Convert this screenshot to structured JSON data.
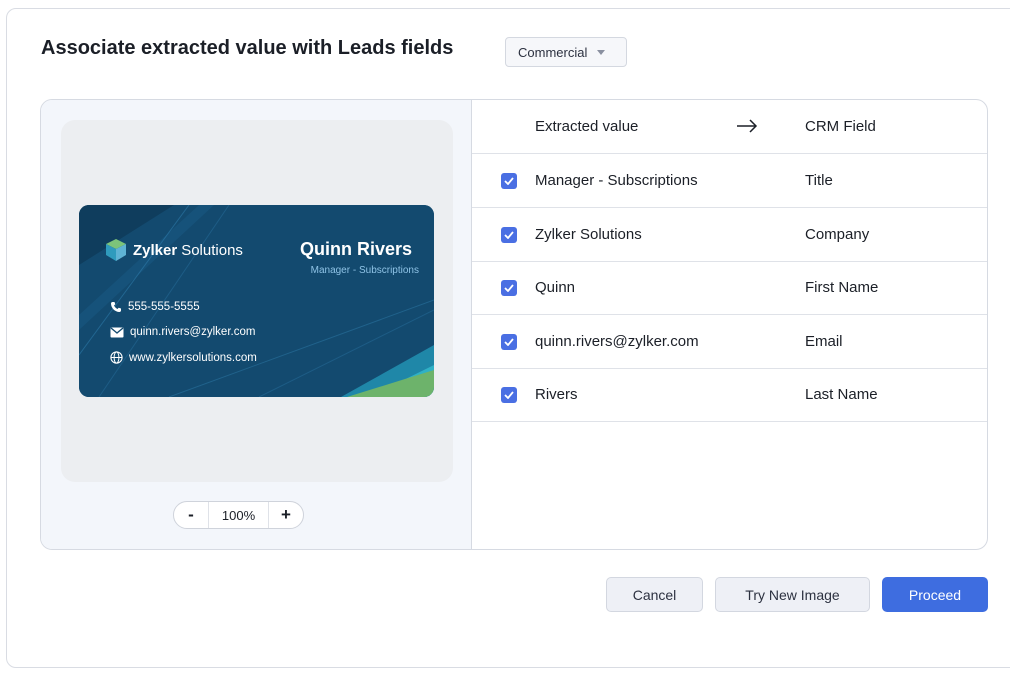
{
  "dialog": {
    "title": "Associate extracted value with Leads fields",
    "layout_select": {
      "value": "Commercial"
    }
  },
  "preview": {
    "card": {
      "brand_bold": "Zylker",
      "brand_rest": "Solutions",
      "name": "Quinn Rivers",
      "role": "Manager - Subscriptions",
      "phone": "555-555-5555",
      "email": "quinn.rivers@zylker.com",
      "website": "www.zylkersolutions.com"
    },
    "zoom": {
      "minus": "-",
      "value": "100%",
      "plus": "+"
    }
  },
  "mapping": {
    "header": {
      "extracted": "Extracted value",
      "crm": "CRM Field"
    },
    "rows": [
      {
        "value": "Manager - Subscriptions",
        "field": "Title",
        "checked": true
      },
      {
        "value": "Zylker Solutions",
        "field": "Company",
        "checked": true
      },
      {
        "value": "Quinn",
        "field": "First Name",
        "checked": true
      },
      {
        "value": "quinn.rivers@zylker.com",
        "field": "Email",
        "checked": true
      },
      {
        "value": "Rivers",
        "field": "Last Name",
        "checked": true
      }
    ]
  },
  "actions": {
    "cancel": "Cancel",
    "try_new": "Try New Image",
    "proceed": "Proceed"
  },
  "colors": {
    "accent": "#3e6de0",
    "checkbox": "#4a6fe3",
    "card_bg": "#134a6f"
  }
}
